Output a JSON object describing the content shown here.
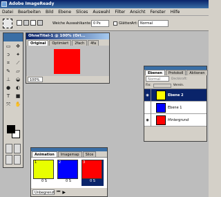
{
  "app": {
    "title": "Adobe ImageReady"
  },
  "menu": [
    "Datei",
    "Bearbeiten",
    "Bild",
    "Ebene",
    "Slices",
    "Auswahl",
    "Filter",
    "Ansicht",
    "Fenster",
    "Hilfe"
  ],
  "options": {
    "feather_label": "Weiche Auswahlkante:",
    "feather_value": "0 Px",
    "antialias_label": "Glätten",
    "style_label": "Art:",
    "style_value": "Normal"
  },
  "document": {
    "title": "OhneTitel-1 @ 100% (Ori...",
    "tabs": [
      "Original",
      "Optimiert",
      "2fach",
      "4fa"
    ],
    "zoom": "100%",
    "canvas_color": "#ff0000"
  },
  "layers": {
    "tabs": [
      "Ebenen",
      "Protokoll",
      "Aktionen"
    ],
    "blend_mode": "Normal",
    "opacity_label": "Deckkraft:",
    "lock_label": "Fix:",
    "unify_label": "Verein.",
    "items": [
      {
        "name": "Ebene 2",
        "color": "#ffff00",
        "selected": true
      },
      {
        "name": "Ebene 1",
        "color": "#0000ff",
        "selected": false
      },
      {
        "name": "Hintergrund",
        "color": "#ff0000",
        "selected": false
      }
    ]
  },
  "animation": {
    "tabs": [
      "Animation",
      "Imagemap",
      "Slice"
    ],
    "frames": [
      {
        "num": "1",
        "color": "#e8ff00",
        "delay": "0 S"
      },
      {
        "num": "2",
        "color": "#0000ff",
        "delay": "0 S"
      },
      {
        "num": "3",
        "color": "#ff0000",
        "delay": "0 S"
      }
    ],
    "loop": "Unbegrenzt"
  },
  "colors": {
    "foreground": "#000000",
    "background": "#ffffff",
    "accent": "#0a246a"
  }
}
